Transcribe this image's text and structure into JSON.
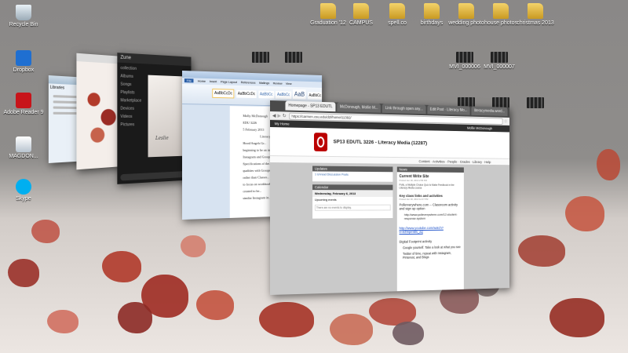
{
  "desktop": {
    "icons": [
      {
        "name": "recycle-bin-icon",
        "label": "Recycle Bin"
      },
      {
        "name": "dropbox-icon",
        "label": "Dropbox"
      },
      {
        "name": "adobe-reader-icon",
        "label": "Adobe Reader 9"
      },
      {
        "name": "file-icon",
        "label": "MAGDON..."
      },
      {
        "name": "skype-icon",
        "label": "Skype"
      }
    ],
    "folders": [
      {
        "label": "Graduation '12"
      },
      {
        "label": "CAMPUS"
      },
      {
        "label": "spell.co"
      },
      {
        "label": "birthdays"
      },
      {
        "label": "wedding photo"
      },
      {
        "label": "house photos"
      },
      {
        "label": "christmas 2013"
      }
    ],
    "videos": [
      {
        "label": "MVI_000006"
      },
      {
        "label": "MVI_000007"
      }
    ]
  },
  "browser": {
    "tabs": [
      "Homepage - SP13 EDUTL",
      "McDonough, Mollie M...",
      "Link through open any...",
      "Edit Post - Literacy Mo...",
      "literacymedia.word..."
    ],
    "address": "https://carmen.osu.edu/d2l/home/11392/",
    "nav_label": "My Home",
    "course_title": "SP13 EDUTL 3226 - Literacy Media (12287)",
    "user": "Mollie McDonough",
    "menu": [
      "Content",
      "Activities",
      "People",
      "Grades",
      "Library",
      "Help"
    ],
    "updates_title": "Updates",
    "updates_item": "1 Unread Discussion Posts",
    "calendar_title": "Calendar",
    "calendar_date": "Wednesday, February 6, 2013",
    "upcoming": "Upcoming events",
    "no_events": "There are no events to display.",
    "news_title": "News",
    "news_heading": "Current Write Site",
    "news_date": "Posted Jan 30, 2013 2:55 PM",
    "news_blurb": "Polls, a Multiple Choice Quiz to Make Feedback in the Literacy Media course",
    "news_link_heading": "Key class links and activities",
    "news_link_date": "Posted Jan 30, 2013 12:47 PM",
    "news_lines": [
      "Pollerverywhere.com -- Classroom activity and sign up option",
      "http://www.polleverywhere.com/12-student-response-system"
    ],
    "video_url": "http://www.youtube.com/watch?v=eZmpmMs_aq",
    "footprint_title": "Digital Footprint activity",
    "footprint_items": [
      "Google yourself. Take a look at what you see",
      "Twitter of time, repeat with Instagram, Pinterest, and Blogs"
    ]
  },
  "word": {
    "tabs": [
      "File",
      "Home",
      "Insert",
      "Page Layout",
      "References",
      "Mailings",
      "Review",
      "View"
    ],
    "styles": [
      "AaBbCcDc",
      "AaBbCcDc",
      "AaBbCc",
      "AaBbCc",
      "AaB",
      "AaBbCc",
      "AaBbCcD"
    ],
    "doc_lines": [
      "Molly McDonough",
      "EDU 3226",
      "5 February 2013",
      "Literacy...",
      "Hood/Angels Gr...",
      "beginning to be an integral...",
      "Instagram and Group...",
      "Specifications of the...",
      "qualities with Groups...",
      "rather than Classes...",
      "to focus on workbook...",
      "created to be...",
      "similar Instagram in..."
    ]
  },
  "music": {
    "title": "Zune",
    "sidebar": [
      "collection",
      "Albums",
      "Songs",
      "Playlists",
      "Marketplace",
      "Devices",
      "Videos",
      "Pictures"
    ],
    "caption": "Leslie"
  },
  "explorer": {
    "title": "Libraries"
  }
}
